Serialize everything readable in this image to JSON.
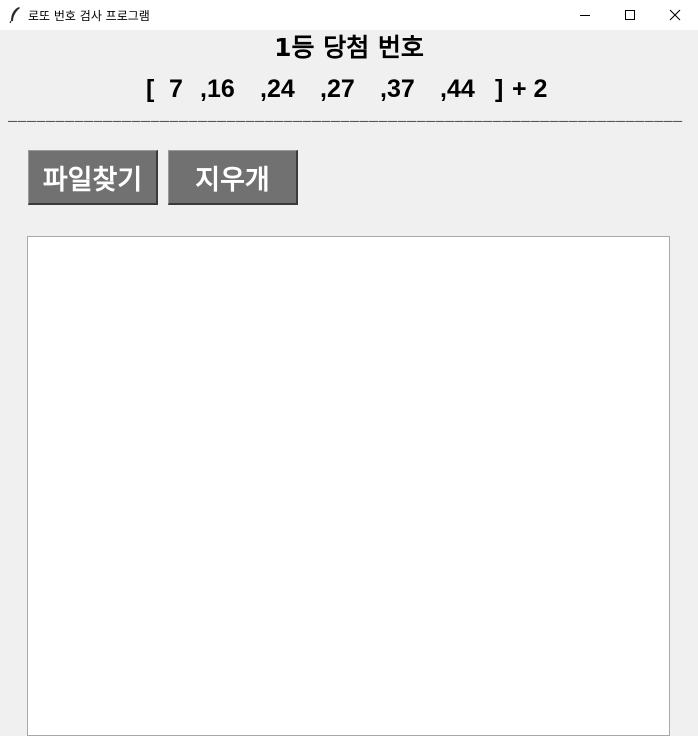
{
  "window": {
    "title": "로또 번호 검사 프로그램",
    "icon": "feather-icon",
    "controls": [
      "minimize-icon",
      "maximize-icon",
      "close-icon"
    ]
  },
  "header": {
    "title": "1등 당첨 번호",
    "numbers": {
      "open_bracket": "[",
      "n1": "7",
      "n2": ",16",
      "n3": ",24",
      "n4": ",27",
      "n5": ",37",
      "n6": ",44",
      "close_bracket": "]",
      "bonus": "+ 2"
    },
    "divider": "_______________________________________________________________________"
  },
  "buttons": {
    "find_file": "파일찾기",
    "clear": "지우개"
  },
  "colors": {
    "window_bg": "#f0f0f0",
    "button_bg": "#717171",
    "button_text": "#ffffff",
    "textarea_bg": "#ffffff"
  },
  "output": {
    "value": ""
  }
}
